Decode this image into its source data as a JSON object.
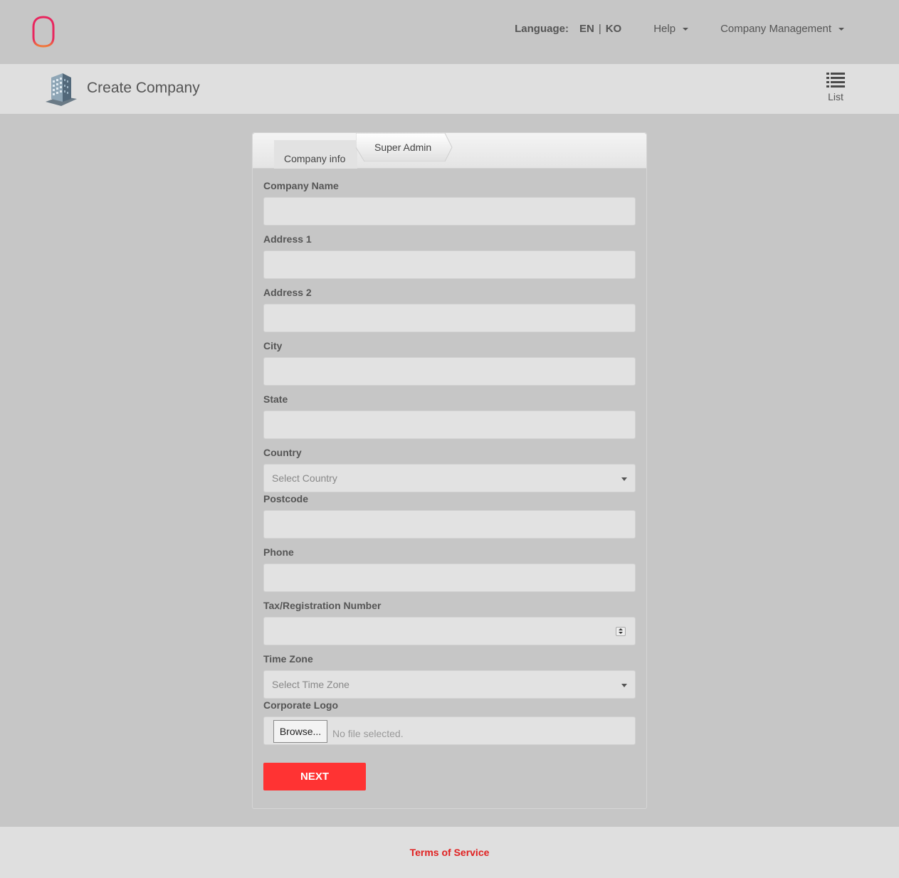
{
  "topnav": {
    "language_label": "Language:",
    "lang_en": "EN",
    "lang_separator": "|",
    "lang_ko": "KO",
    "help": "Help",
    "company_management": "Company Management"
  },
  "header": {
    "title": "Create Company",
    "list_label": "List"
  },
  "tabs": {
    "company_info": "Company info",
    "super_admin": "Super Admin"
  },
  "form": {
    "company_name": {
      "label": "Company Name",
      "value": ""
    },
    "address1": {
      "label": "Address 1",
      "value": ""
    },
    "address2": {
      "label": "Address 2",
      "value": ""
    },
    "city": {
      "label": "City",
      "value": ""
    },
    "state": {
      "label": "State",
      "value": ""
    },
    "country": {
      "label": "Country",
      "placeholder": "Select Country"
    },
    "postcode": {
      "label": "Postcode",
      "value": ""
    },
    "phone": {
      "label": "Phone",
      "value": ""
    },
    "tax": {
      "label": "Tax/Registration Number",
      "value": ""
    },
    "timezone": {
      "label": "Time Zone",
      "placeholder": "Select Time Zone"
    },
    "logo": {
      "label": "Corporate Logo",
      "browse": "Browse...",
      "status": "No file selected."
    }
  },
  "actions": {
    "next": "NEXT"
  },
  "footer": {
    "terms": "Terms of Service"
  },
  "colors": {
    "accent": "#ff3333",
    "logo_pink": "#e8265e",
    "logo_orange": "#f07a3a",
    "link": "#e02020"
  }
}
